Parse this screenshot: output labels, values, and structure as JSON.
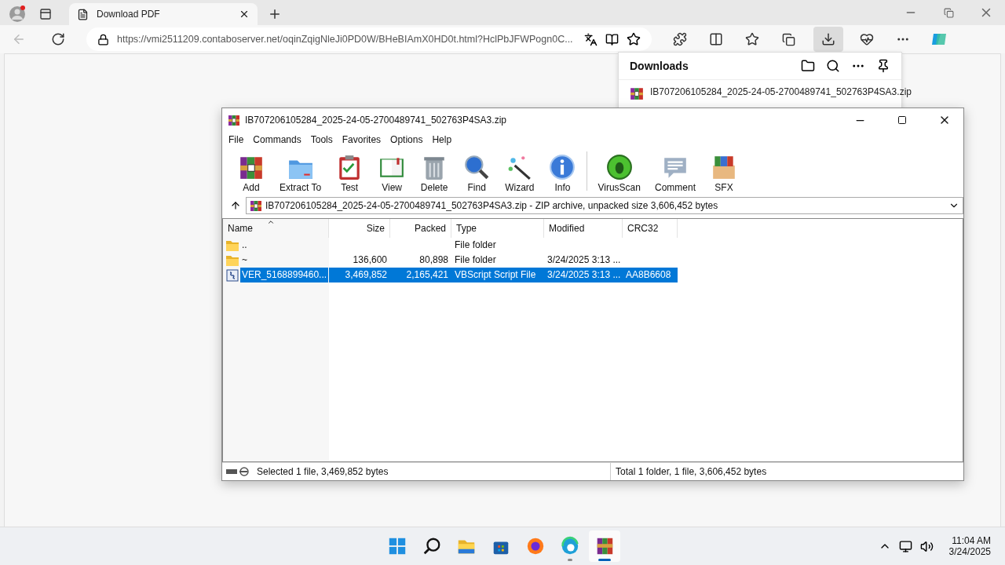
{
  "browser": {
    "tabs": [
      {
        "title": "Download PDF",
        "selected": true
      }
    ],
    "address": "https://vmi2511209.contaboserver.net/oqinZqigNleJi0PD0W/BHeBIAmX0HD0t.html?HclPbJFWPogn0C...",
    "downloads": {
      "title": "Downloads",
      "items": [
        {
          "name": "IB707206105284_2025-24-05-2700489741_502763P4SA3.zip"
        }
      ]
    }
  },
  "winrar": {
    "title": "IB707206105284_2025-24-05-2700489741_502763P4SA3.zip",
    "menu": [
      "File",
      "Commands",
      "Tools",
      "Favorites",
      "Options",
      "Help"
    ],
    "toolbar": [
      "Add",
      "Extract To",
      "Test",
      "View",
      "Delete",
      "Find",
      "Wizard",
      "Info",
      "VirusScan",
      "Comment",
      "SFX"
    ],
    "path": "IB707206105284_2025-24-05-2700489741_502763P4SA3.zip - ZIP archive, unpacked size 3,606,452 bytes",
    "columns": [
      "Name",
      "Size",
      "Packed",
      "Type",
      "Modified",
      "CRC32"
    ],
    "rows": [
      {
        "kind": "folder",
        "selected": false,
        "cells": [
          "..",
          "",
          "",
          "File folder",
          "",
          ""
        ]
      },
      {
        "kind": "folder",
        "selected": false,
        "cells": [
          "~",
          "136,600",
          "80,898",
          "File folder",
          "3/24/2025 3:13 ...",
          ""
        ]
      },
      {
        "kind": "script",
        "selected": true,
        "cells": [
          "VER_5168899460...",
          "3,469,852",
          "2,165,421",
          "VBScript Script File",
          "3/24/2025 3:13 ...",
          "AA8B6608"
        ]
      }
    ],
    "status_left": "Selected 1 file, 3,469,852 bytes",
    "status_right": "Total 1 folder, 1 file, 3,606,452 bytes"
  },
  "taskbar": {
    "apps": [
      {
        "running": false,
        "active": false
      },
      {
        "running": false,
        "active": false
      },
      {
        "running": false,
        "active": false
      },
      {
        "running": false,
        "active": false
      },
      {
        "running": false,
        "active": false
      },
      {
        "running": true,
        "active": false
      },
      {
        "running": true,
        "active": true
      }
    ],
    "time": "11:04 AM",
    "date": "3/24/2025"
  }
}
